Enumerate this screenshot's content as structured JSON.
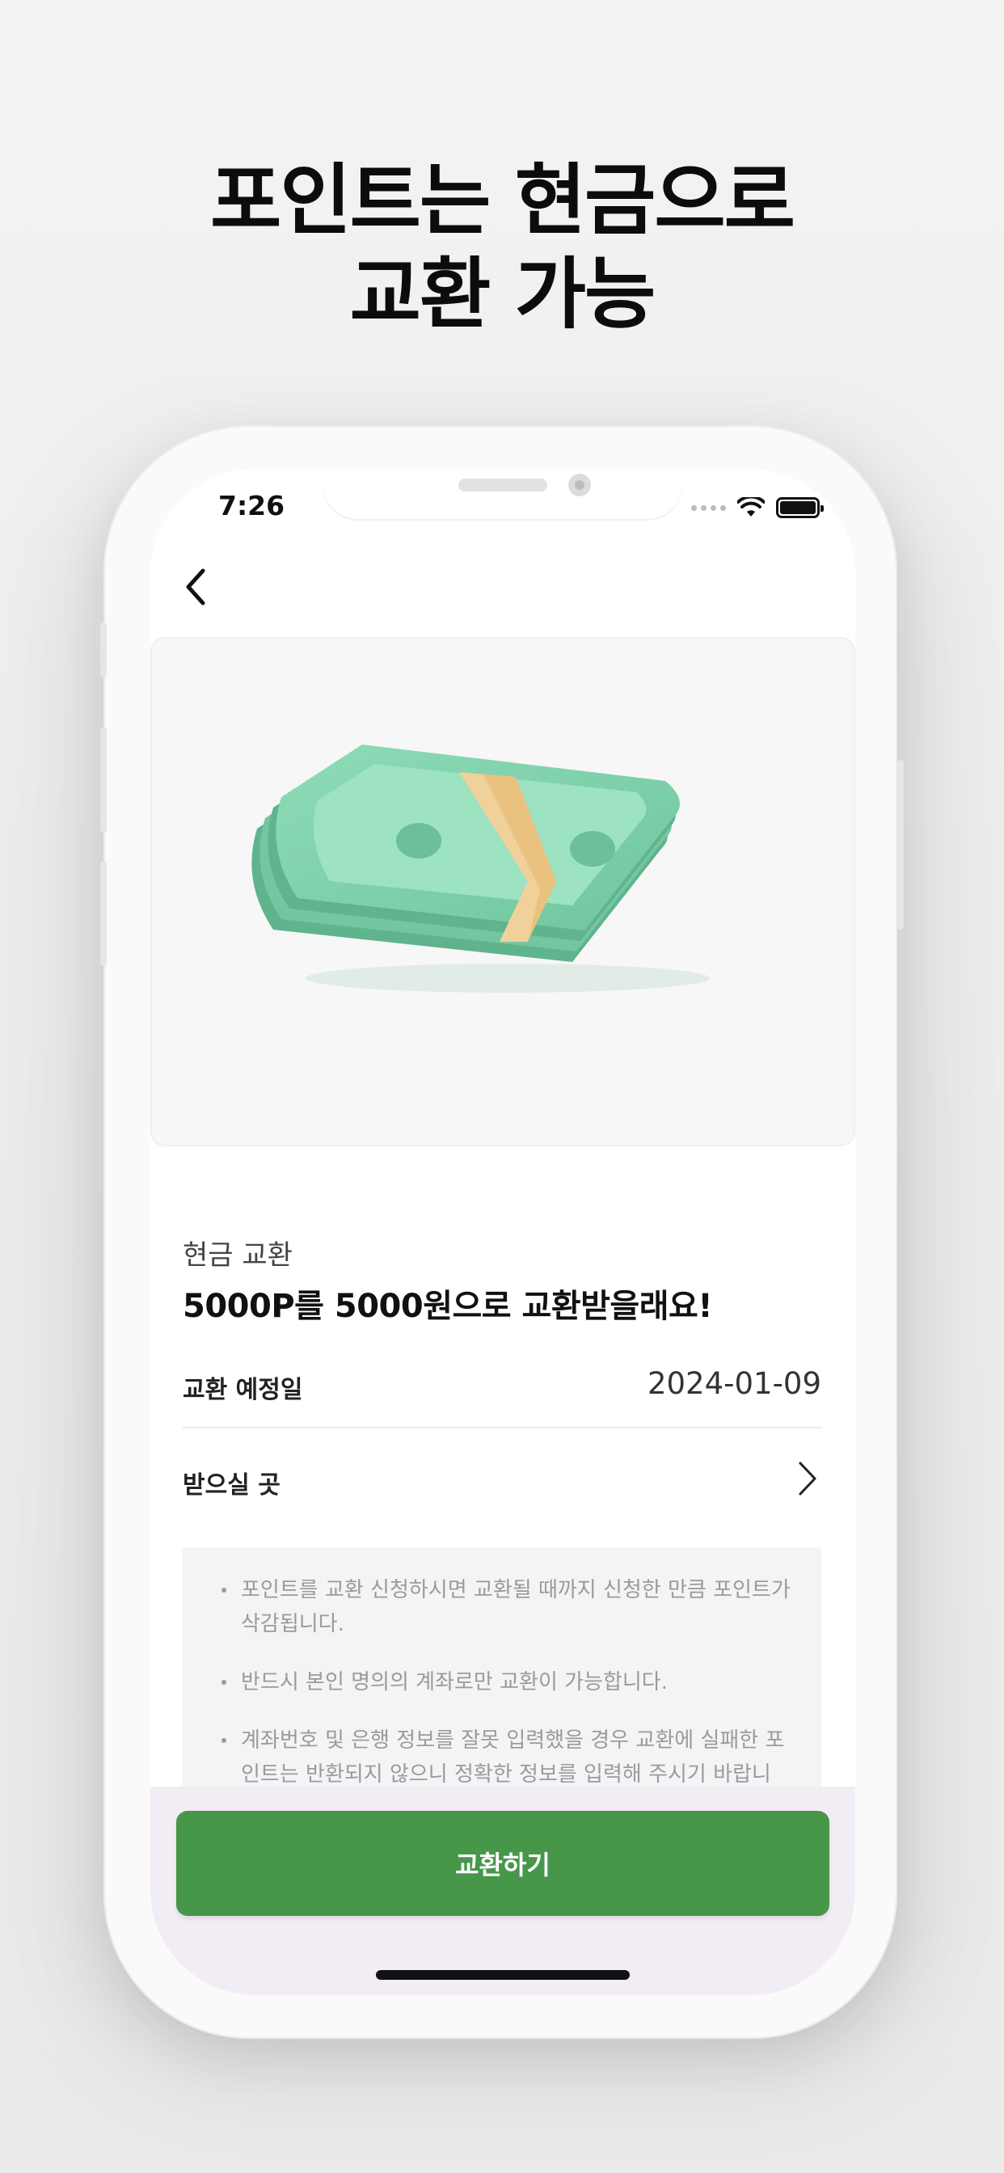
{
  "headline": {
    "line1": "포인트는 현금으로",
    "line2": "교환 가능"
  },
  "status_bar": {
    "time": "7:26"
  },
  "product": {
    "category": "현금 교환",
    "title": "5000P를 5000원으로 교환받을래요!"
  },
  "details": {
    "exchange_date_label": "교환 예정일",
    "exchange_date_value": "2024-01-09",
    "destination_label": "받으실 곳"
  },
  "notices": [
    "포인트를 교환 신청하시면 교환될 때까지 신청한 만큼 포인트가 삭감됩니다.",
    "반드시 본인 명의의 계좌로만 교환이 가능합니다.",
    "계좌번호 및 은행 정보를 잘못 입력했을 경우 교환에 실패한 포인트는 반환되지 않으니 정확한 정보를 입력해 주시기 바랍니다."
  ],
  "cta": {
    "label": "교환하기"
  },
  "colors": {
    "accent": "#46974a",
    "bill": "#7fd1ad",
    "band": "#e9c27f"
  }
}
